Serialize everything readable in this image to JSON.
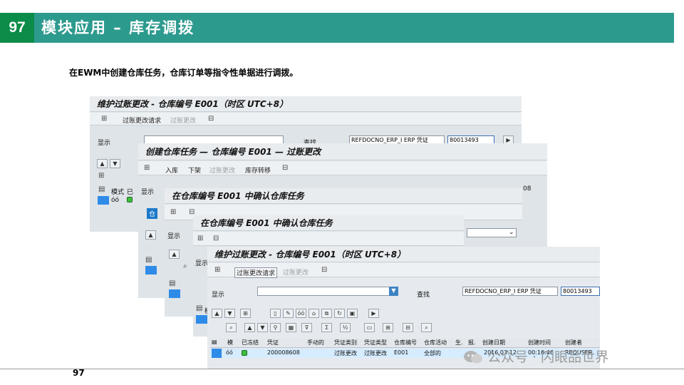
{
  "slide": {
    "number": "97",
    "title": "模块应用 – 库存调拨",
    "intro": "在EWM中创建仓库任务，仓库订单等指令性单据进行调拨。",
    "page_number": "97"
  },
  "windows": {
    "back1": {
      "title": "维护过账更改 - 仓库编号 E001（时区 UTC+8）",
      "tb_post_request": "过账更改请求",
      "tb_post_change": "过账更改",
      "display_label": "显示",
      "find_label": "查找",
      "find_field_value": "REFDOCNO_ERP_I ERP 凭证",
      "find_value": "80013493",
      "col_mode": "模式",
      "col_done": "已"
    },
    "back2": {
      "title": "创建仓库任务 — 仓库编号 E001 — 过账更改",
      "tb_putaway": "入库",
      "tb_pick": "下架",
      "tb_post_change": "过账更改",
      "tb_stock_transfer": "库存转移",
      "display_label": "显示",
      "partial_value": "08",
      "tab_label": "仓"
    },
    "back3": {
      "title": "在仓库编号 E001 中确认仓库任务",
      "display_label": "显示"
    },
    "back4": {
      "title": "在仓库编号 E001 中确认仓库任务",
      "display_label": "显示",
      "col_mode": "模式"
    },
    "front": {
      "title": "维护过账更改 - 仓库编号 E001（时区 UTC+8）",
      "tb_post_request": "过账更改请求",
      "tb_post_change": "过账更改",
      "display_label": "显示",
      "find_label": "查找",
      "find_field_value": "REFDOCNO_ERP_I ERP 凭证",
      "find_value": "80013493",
      "columns": [
        "模",
        "已冻结",
        "凭证",
        "手动的",
        "凭证类别",
        "凭证类型",
        "仓库编号",
        "仓库活动",
        "生.",
        "报.",
        "创建日期",
        "创建时间",
        "创建者"
      ],
      "row": {
        "document": "200008608",
        "doc_category": "过账更改",
        "doc_type": "过账更改",
        "warehouse": "E001",
        "activity": "全部的",
        "date": "2016.03.12",
        "time": "00:16:46",
        "creator": "REQUSER"
      }
    }
  },
  "watermark": "公众号 · 闪眼品世界",
  "colors": {
    "header_teal": "#2d9a8e",
    "number_green": "#0b8c48",
    "sap_background": "#dfe4e8",
    "selection_blue": "#2e8be8",
    "row_highlight": "#d6ecff"
  },
  "icons": [
    "wizard-icon",
    "save-icon",
    "dropdown-icon",
    "execute-icon",
    "filter-icon",
    "sort-icon",
    "sum-icon",
    "excel-icon",
    "detail-icon",
    "status-green-icon"
  ]
}
